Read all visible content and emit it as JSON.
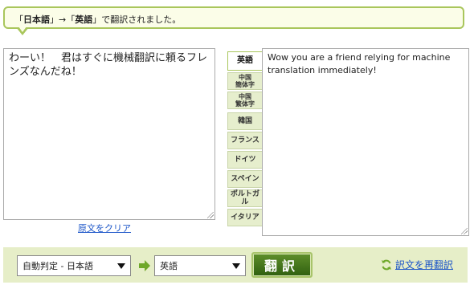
{
  "message": {
    "open1": "「",
    "from_lang": "日本語",
    "close1": "」",
    "arrow": "→",
    "open2": "「",
    "to_lang": "英語",
    "close2": "」",
    "suffix": "で翻訳されました。"
  },
  "source_text": "わーい！　君はすぐに機械翻訳に頼るフレンズなんだね！",
  "clear_link": "原文をクリア",
  "tabs": [
    {
      "label": "英語",
      "active": true
    },
    {
      "label1": "中国",
      "label2": "簡体字"
    },
    {
      "label1": "中国",
      "label2": "繁体字"
    },
    {
      "label": "韓国"
    },
    {
      "label": "フランス"
    },
    {
      "label": "ドイツ"
    },
    {
      "label": "スペイン"
    },
    {
      "label": "ポルトガル"
    },
    {
      "label": "イタリア"
    }
  ],
  "translated_text": "Wow you are a friend relying for machine translation immediately!",
  "source_select": "自動判定 - 日本語",
  "target_select": "英語",
  "translate_button": "翻訳",
  "retranslate_link": "訳文を再翻訳",
  "colors": {
    "accent": "#a9c65c",
    "bar": "#e6eec8",
    "link": "#1d56c8",
    "button": "#3f6f18"
  }
}
